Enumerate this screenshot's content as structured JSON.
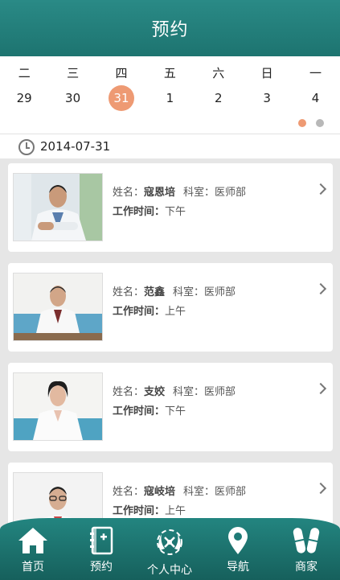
{
  "header": {
    "title": "预约"
  },
  "calendar": {
    "weekdays": [
      "二",
      "三",
      "四",
      "五",
      "六",
      "日",
      "一"
    ],
    "dates": [
      "29",
      "30",
      "31",
      "1",
      "2",
      "3",
      "4"
    ],
    "selected_index": 2,
    "selected_color": "#ee9a73",
    "page_dots": 2,
    "active_dot": 0
  },
  "selected_date": "2014-07-31",
  "doctors": [
    {
      "name_label": "姓名：",
      "name": "寇恩培",
      "dept_label": "科室：",
      "dept": "医师部",
      "time_label": "工作时间：",
      "time": "下午",
      "photo": "doctor-photo-male-arms-crossed"
    },
    {
      "name_label": "姓名：",
      "name": "范鑫",
      "dept_label": "科室：",
      "dept": "医师部",
      "time_label": "工作时间：",
      "time": "上午",
      "photo": "doctor-photo-male-desk"
    },
    {
      "name_label": "姓名：",
      "name": "支姣",
      "dept_label": "科室：",
      "dept": "医师部",
      "time_label": "工作时间：",
      "time": "下午",
      "photo": "doctor-photo-female"
    },
    {
      "name_label": "姓名：",
      "name": "寇岐培",
      "dept_label": "科室：",
      "dept": "医师部",
      "time_label": "工作时间：",
      "time": "上午",
      "photo": "doctor-photo-male-glasses"
    }
  ],
  "tabbar": {
    "items": [
      {
        "label": "首页",
        "icon": "home-icon"
      },
      {
        "label": "预约",
        "icon": "book-plus-icon"
      },
      {
        "label": "个人中心",
        "icon": "logo-wreath-icon"
      },
      {
        "label": "导航",
        "icon": "map-pin-icon"
      },
      {
        "label": "商家",
        "icon": "pills-icon"
      }
    ]
  },
  "colors": {
    "brand": "#1f7b77",
    "accent": "#ee9a73"
  }
}
